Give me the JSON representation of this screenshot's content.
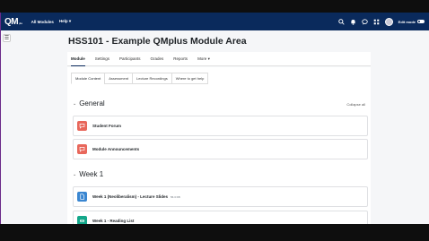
{
  "navbar": {
    "logo_main": "QM",
    "logo_sub": "plus",
    "links": [
      "All Modules",
      "Help ▾"
    ],
    "edit_mode_label": "Edit mode"
  },
  "page": {
    "title": "HSS101 - Example QMplus Module Area"
  },
  "secondary_nav": [
    "Module",
    "Settings",
    "Participants",
    "Grades",
    "Reports",
    "More ▾"
  ],
  "tabs": [
    "Module Content",
    "Assessment",
    "Lecture Recordings",
    "Where to get help"
  ],
  "sections": [
    {
      "title": "General",
      "collapse_label": "Collapse all",
      "activities": [
        {
          "name": "Student Forum",
          "icon": "forum-icon",
          "color": "#e8675b"
        },
        {
          "name": "Module Announcements",
          "icon": "forum-icon",
          "color": "#e8675b"
        }
      ]
    },
    {
      "title": "Week 1",
      "activities": [
        {
          "name": "Week 1 (Neoliberalism) - Lecture Slides",
          "meta": "56.3 KB",
          "icon": "file-icon",
          "color": "#3a86d1"
        },
        {
          "name": "Week 1 - Reading List",
          "icon": "reading-list-icon",
          "color": "#14a78a"
        }
      ]
    }
  ]
}
